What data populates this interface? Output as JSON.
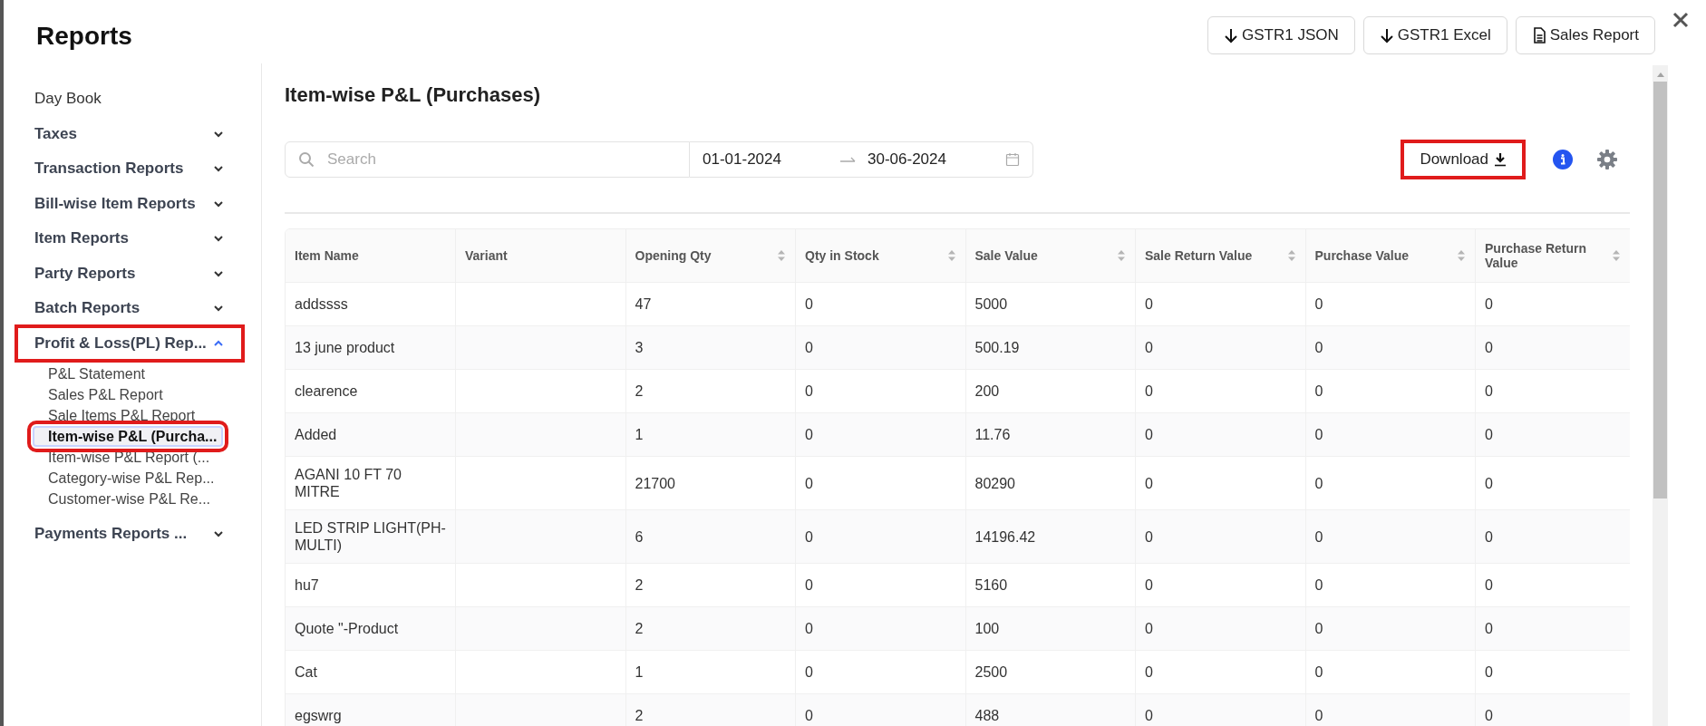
{
  "window": {
    "title": "Reports"
  },
  "header_buttons": [
    {
      "label": "GSTR1 JSON",
      "kind": "download"
    },
    {
      "label": "GSTR1 Excel",
      "kind": "download"
    },
    {
      "label": "Sales Report",
      "kind": "document"
    }
  ],
  "sidebar": {
    "items": [
      {
        "label": "Day Book",
        "kind": "link"
      },
      {
        "label": "Taxes",
        "kind": "group",
        "expanded": false,
        "highlighted": false
      },
      {
        "label": "Transaction Reports",
        "kind": "group",
        "expanded": false,
        "highlighted": false
      },
      {
        "label": "Bill-wise Item Reports",
        "kind": "group",
        "expanded": false,
        "highlighted": false
      },
      {
        "label": "Item Reports",
        "kind": "group",
        "expanded": false,
        "highlighted": false
      },
      {
        "label": "Party Reports",
        "kind": "group",
        "expanded": false,
        "highlighted": false
      },
      {
        "label": "Batch Reports",
        "kind": "group",
        "expanded": false,
        "highlighted": false
      },
      {
        "label": "Profit & Loss(PL) Rep...",
        "kind": "group",
        "expanded": true,
        "highlighted": true,
        "children": [
          {
            "label": "P&L Statement",
            "selected": false,
            "highlighted": false
          },
          {
            "label": "Sales P&L Report",
            "selected": false,
            "highlighted": false
          },
          {
            "label": "Sale Items P&L Report",
            "selected": false,
            "highlighted": false
          },
          {
            "label": "Item-wise P&L (Purcha...",
            "selected": true,
            "highlighted": true
          },
          {
            "label": "Item-wise P&L Report (...",
            "selected": false,
            "highlighted": false
          },
          {
            "label": "Category-wise P&L Rep...",
            "selected": false,
            "highlighted": false
          },
          {
            "label": "Customer-wise P&L Re...",
            "selected": false,
            "highlighted": false
          }
        ]
      },
      {
        "label": "Payments Reports ...",
        "kind": "group",
        "expanded": false,
        "highlighted": false
      }
    ]
  },
  "report": {
    "title": "Item-wise P&L (Purchases)",
    "search": {
      "placeholder": "Search"
    },
    "date_from": "01-01-2024",
    "date_to": "30-06-2024",
    "download": {
      "label": "Download",
      "highlighted": true
    },
    "table": {
      "columns": [
        {
          "label": "Item Name",
          "sortable": false
        },
        {
          "label": "Variant",
          "sortable": false
        },
        {
          "label": "Opening Qty",
          "sortable": true
        },
        {
          "label": "Qty in Stock",
          "sortable": true
        },
        {
          "label": "Sale Value",
          "sortable": true
        },
        {
          "label": "Sale Return Value",
          "sortable": true
        },
        {
          "label": "Purchase Value",
          "sortable": true
        },
        {
          "label": "Purchase Return Value",
          "sortable": true
        }
      ],
      "rows": [
        [
          "addssss",
          null,
          "47",
          "0",
          "5000",
          "0",
          "0",
          "0"
        ],
        [
          "13 june product",
          null,
          "3",
          "0",
          "500.19",
          "0",
          "0",
          "0"
        ],
        [
          "clearence",
          null,
          "2",
          "0",
          "200",
          "0",
          "0",
          "0"
        ],
        [
          "Added",
          null,
          "1",
          "0",
          "11.76",
          "0",
          "0",
          "0"
        ],
        [
          "AGANI 10 FT 70 MITRE",
          null,
          "21700",
          "0",
          "80290",
          "0",
          "0",
          "0"
        ],
        [
          "LED STRIP LIGHT(PH-MULTI)",
          null,
          "6",
          "0",
          "14196.42",
          "0",
          "0",
          "0"
        ],
        [
          "hu7",
          null,
          "2",
          "0",
          "5160",
          "0",
          "0",
          "0"
        ],
        [
          "Quote \"-Product",
          null,
          "2",
          "0",
          "100",
          "0",
          "0",
          "0"
        ],
        [
          "Cat",
          null,
          "1",
          "0",
          "2500",
          "0",
          "0",
          "0"
        ],
        [
          "egswrg",
          null,
          "2",
          "0",
          "488",
          "0",
          "0",
          "0"
        ]
      ]
    }
  }
}
